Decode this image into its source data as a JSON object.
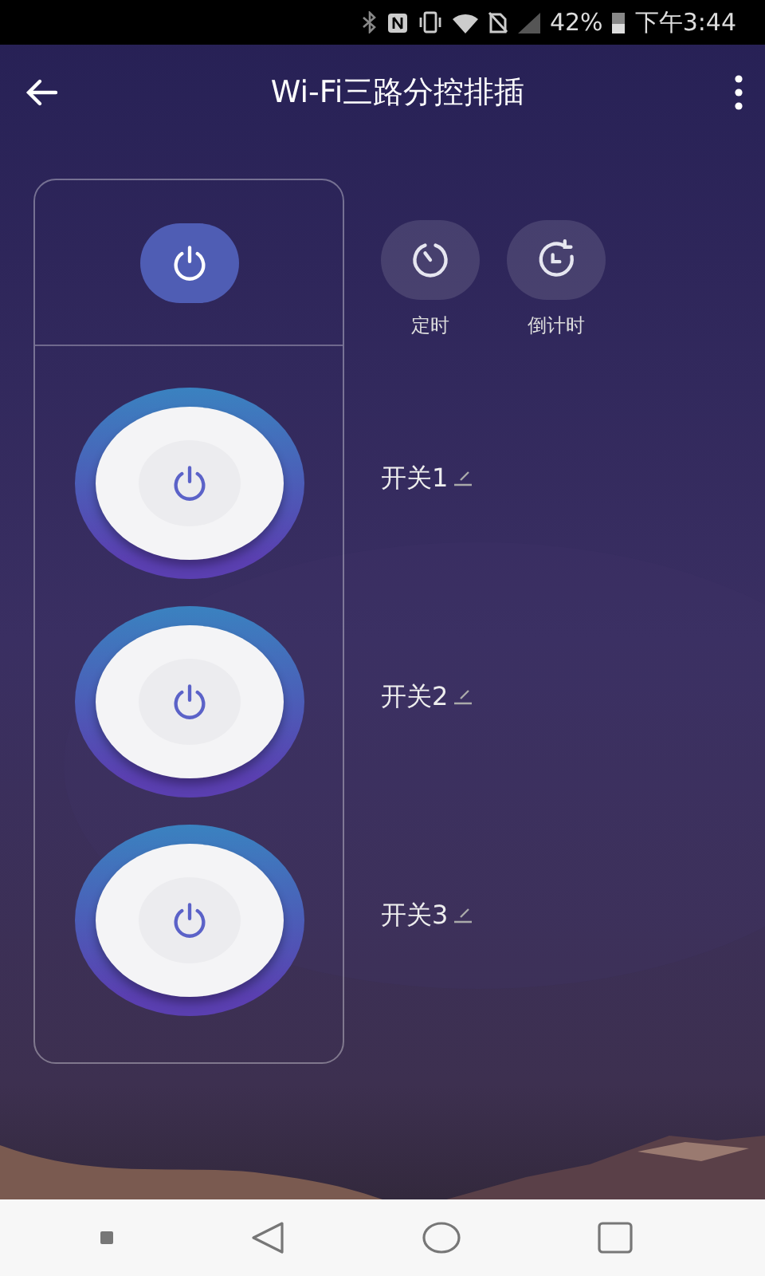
{
  "status_bar": {
    "battery": "42%",
    "time": "下午3:44"
  },
  "header": {
    "title": "Wi-Fi三路分控排插"
  },
  "actions": [
    {
      "kind": "timer",
      "label": "定时"
    },
    {
      "kind": "countdown",
      "label": "倒计时"
    }
  ],
  "switches": [
    {
      "label": "开关1"
    },
    {
      "label": "开关2"
    },
    {
      "label": "开关3"
    }
  ]
}
